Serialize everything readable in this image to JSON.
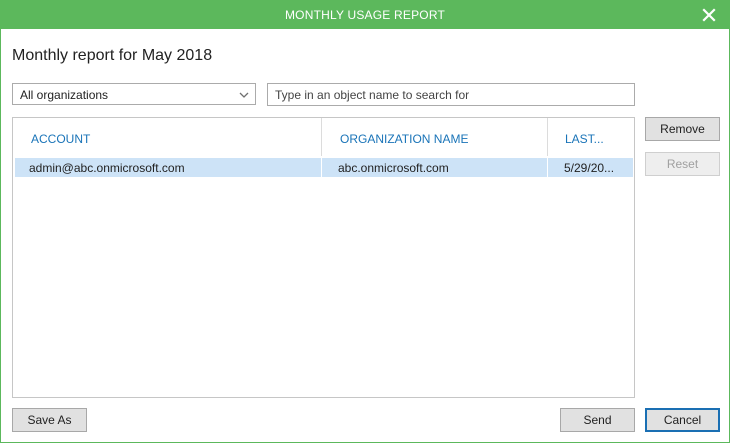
{
  "window": {
    "title": "MONTHLY USAGE REPORT"
  },
  "report": {
    "title": "Monthly report for May 2018"
  },
  "filter": {
    "selected": "All organizations",
    "search_placeholder": "Type in an object name to search for"
  },
  "table": {
    "columns": [
      "ACCOUNT",
      "ORGANIZATION NAME",
      "LAST..."
    ],
    "rows": [
      [
        "admin@abc.onmicrosoft.com",
        "abc.onmicrosoft.com",
        "5/29/20..."
      ]
    ]
  },
  "side_buttons": {
    "remove": "Remove",
    "reset": "Reset"
  },
  "footer": {
    "save_as": "Save As",
    "send": "Send",
    "cancel": "Cancel"
  },
  "colors": {
    "accent": "#5cb85c",
    "header_text": "#1a74b8",
    "selection": "#cde3f7"
  }
}
